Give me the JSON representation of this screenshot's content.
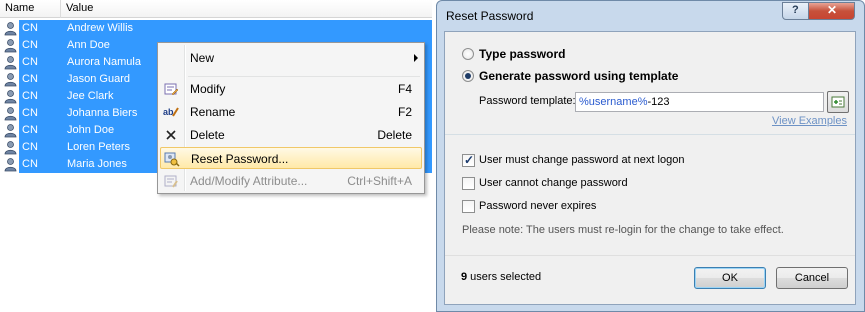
{
  "list": {
    "columns": [
      "Name",
      "Value"
    ],
    "rows": [
      {
        "name": "CN",
        "value": "Andrew Willis"
      },
      {
        "name": "CN",
        "value": "Ann Doe"
      },
      {
        "name": "CN",
        "value": "Aurora Namula"
      },
      {
        "name": "CN",
        "value": "Jason Guard"
      },
      {
        "name": "CN",
        "value": "Jee Clark"
      },
      {
        "name": "CN",
        "value": "Johanna Biers"
      },
      {
        "name": "CN",
        "value": "John Doe"
      },
      {
        "name": "CN",
        "value": "Loren Peters"
      },
      {
        "name": "CN",
        "value": "Maria Jones"
      }
    ]
  },
  "context_menu": {
    "items": [
      {
        "label": "New",
        "shortcut": "",
        "icon": "none",
        "submenu": true
      },
      {
        "label": "Modify",
        "shortcut": "F4",
        "icon": "modify-icon"
      },
      {
        "label": "Rename",
        "shortcut": "F2",
        "icon": "rename-icon"
      },
      {
        "label": "Delete",
        "shortcut": "Delete",
        "icon": "delete-icon"
      },
      {
        "label": "Reset Password...",
        "shortcut": "",
        "icon": "key-icon",
        "highlighted": true
      },
      {
        "label": "Add/Modify Attribute...",
        "shortcut": "Ctrl+Shift+A",
        "icon": "attribute-icon",
        "disabled": true
      }
    ]
  },
  "dialog": {
    "title": "Reset Password",
    "help_glyph": "?",
    "close_glyph": "✕",
    "option_type_password": "Type password",
    "option_generate": "Generate password using template",
    "template_label": "Password template:",
    "template_value_var": "%username%",
    "template_value_rest": "-123",
    "view_examples": "View Examples",
    "check_must_change": "User must change password at next logon",
    "check_cannot_change": "User cannot change password",
    "check_never_expires": "Password never expires",
    "note": "Please note: The users must re-login for the change to take effect.",
    "selected_count": "9",
    "selected_suffix": " users selected",
    "ok_label": "OK",
    "cancel_label": "Cancel"
  },
  "colors": {
    "selection": "#3399ff",
    "menu_highlight": "#ffe9a8",
    "dialog_frame": "#c8d9ec",
    "link": "#6d92c5"
  }
}
